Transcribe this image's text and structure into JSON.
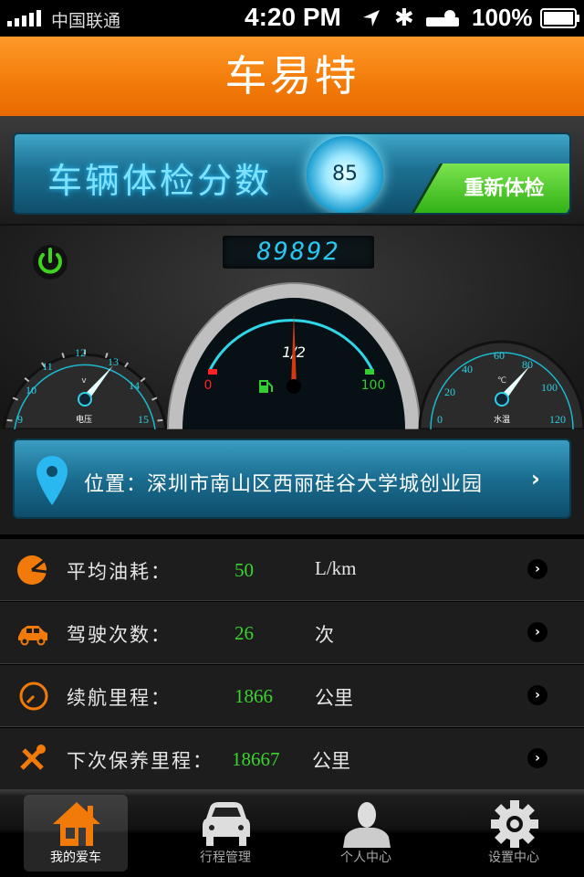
{
  "status_bar": {
    "carrier": "中国联通",
    "time": "4:20 PM",
    "battery": "100%"
  },
  "header": {
    "title": "车易特"
  },
  "score": {
    "label": "车辆体检分数",
    "value": "85",
    "recheck_label": "重新体检"
  },
  "dashboard": {
    "odometer": "89892",
    "voltage": {
      "label": "电压",
      "unit": "v",
      "ticks": [
        "9",
        "10",
        "11",
        "12",
        "13",
        "14",
        "15"
      ],
      "min": 9,
      "max": 15,
      "value": 13
    },
    "fuel": {
      "label": "1/2",
      "min_label": "0",
      "max_label": "100",
      "value": 0.5
    },
    "water_temp": {
      "label": "水温",
      "unit": "℃",
      "ticks": [
        "0",
        "20",
        "40",
        "60",
        "80",
        "100",
        "120"
      ],
      "min": 0,
      "max": 120,
      "value": 80
    }
  },
  "location": {
    "text": "位置：深圳市南山区西丽硅谷大学城创业园",
    "chevron": "›"
  },
  "stats": [
    {
      "label": "平均油耗：",
      "value": "50",
      "unit": "L/km",
      "icon": "gauge-pie-icon"
    },
    {
      "label": "驾驶次数：",
      "value": "26",
      "unit": "次",
      "icon": "car-icon"
    },
    {
      "label": "续航里程：",
      "value": "1866",
      "unit": "公里",
      "icon": "speedometer-icon"
    },
    {
      "label": "下次保养里程：",
      "value": "18667",
      "unit": "公里",
      "icon": "tools-icon"
    }
  ],
  "tabs": [
    {
      "label": "我的爱车",
      "active": true
    },
    {
      "label": "行程管理"
    },
    {
      "label": "个人中心"
    },
    {
      "label": "设置中心"
    }
  ],
  "colors": {
    "accent": "#f27a08",
    "value_green": "#39d42c",
    "cyan": "#2ac6f2"
  }
}
